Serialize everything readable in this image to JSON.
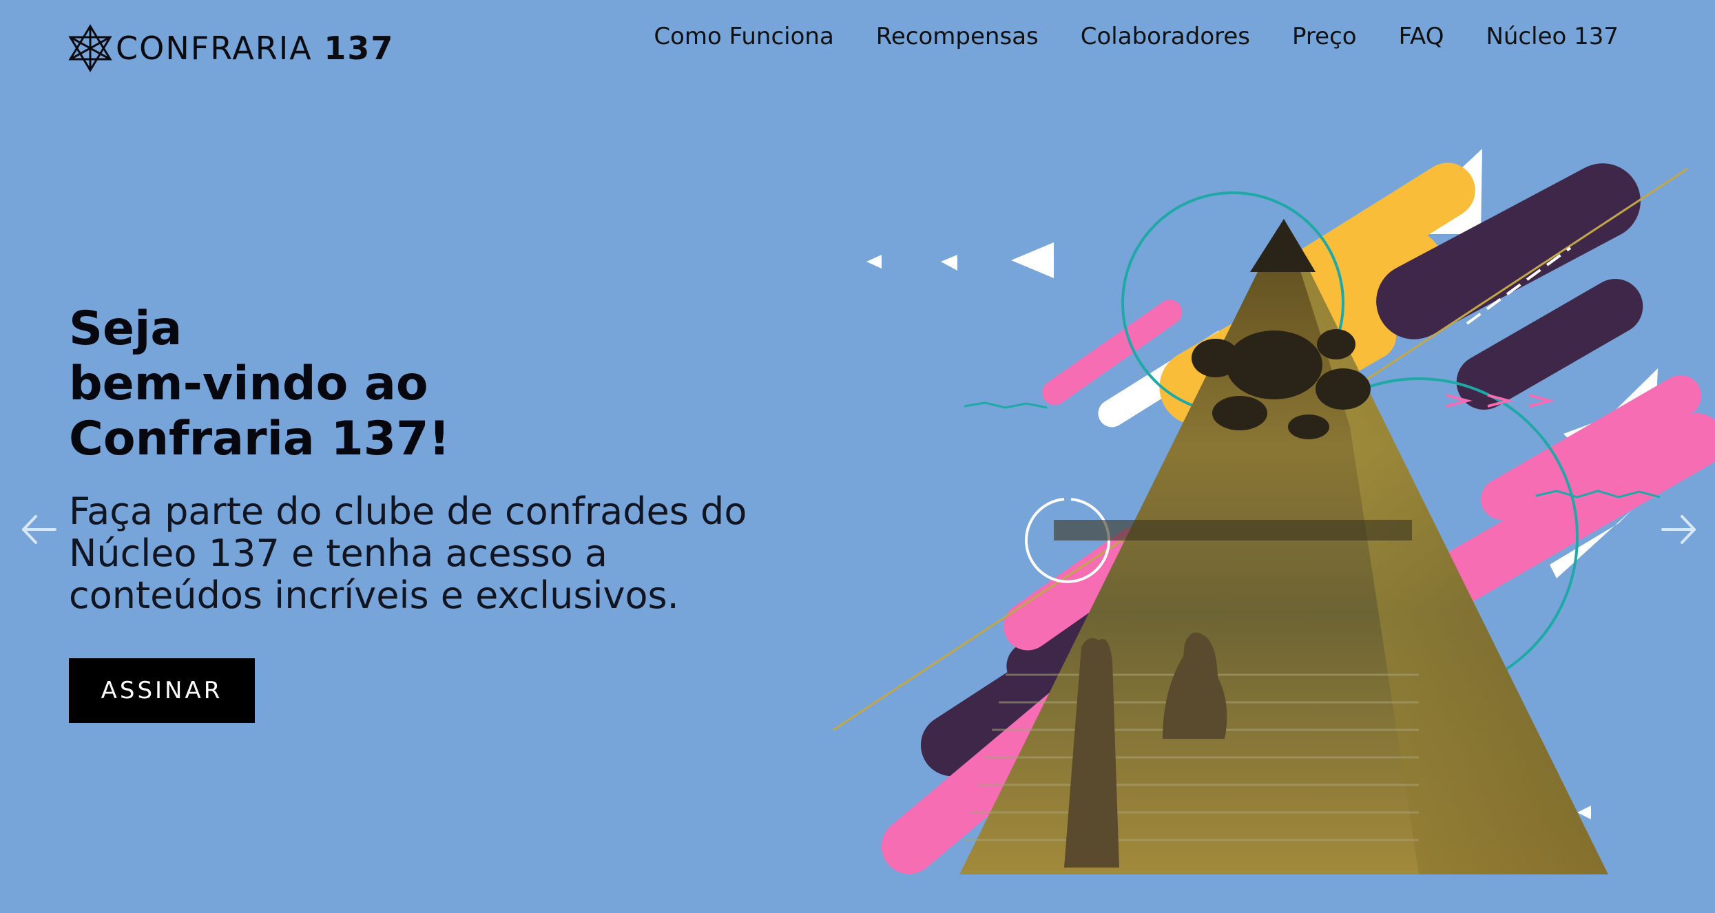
{
  "brand": {
    "logo_text_light": "CONFRARIA",
    "logo_text_bold": "137"
  },
  "nav": {
    "items": [
      {
        "label": "Como Funciona"
      },
      {
        "label": "Recompensas"
      },
      {
        "label": "Colaboradores"
      },
      {
        "label": "Preço"
      },
      {
        "label": "FAQ"
      },
      {
        "label": "Núcleo 137"
      }
    ]
  },
  "hero": {
    "title_lines": [
      "Seja",
      "bem-vindo ao",
      "Confraria 137!"
    ],
    "subtitle": "Faça parte do clube de confrades do Núcleo 137 e tenha acesso a conteúdos incríveis e exclusivos.",
    "cta_label": "ASSINAR"
  },
  "carousel": {
    "prev_icon": "chevron-left-icon",
    "next_icon": "chevron-right-icon"
  },
  "colors": {
    "background": "#78a5d9",
    "cta_bg": "#000000",
    "accent_yellow": "#f9bd3a",
    "accent_pink": "#f66db4",
    "accent_purple": "#3e2749",
    "accent_teal": "#1fa8a6"
  }
}
